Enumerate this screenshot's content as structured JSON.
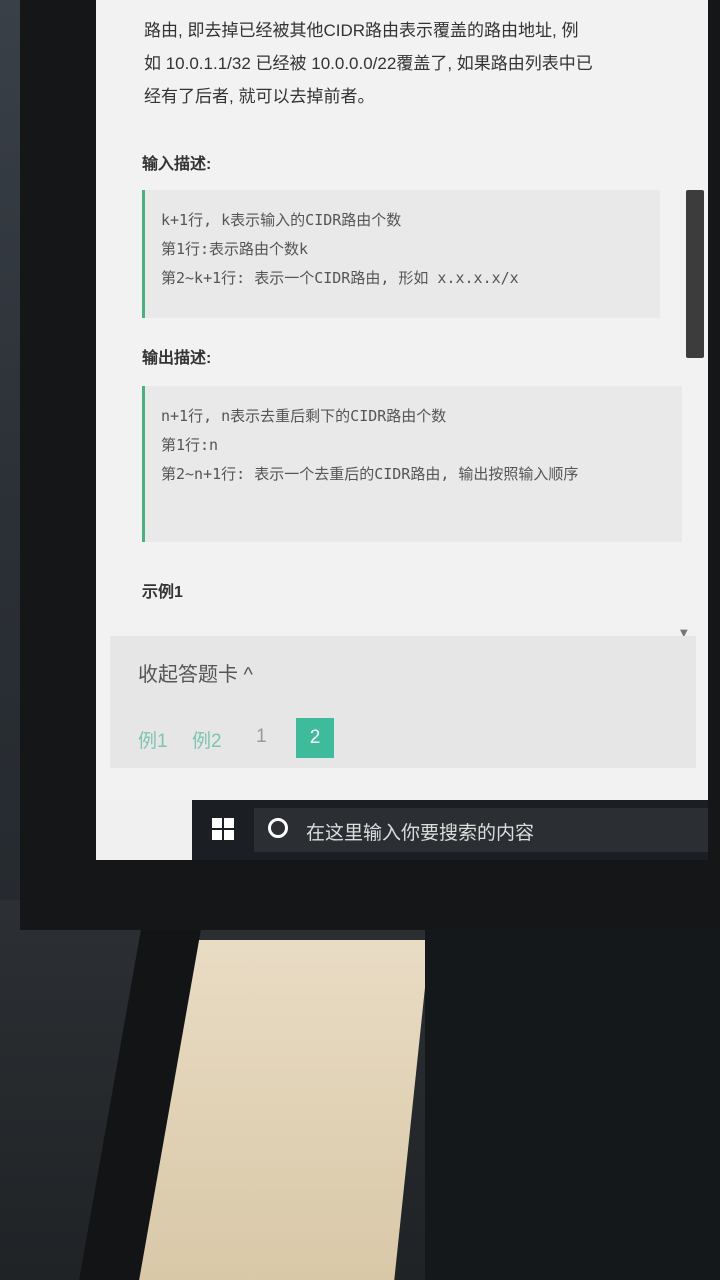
{
  "page": {
    "intro_line1": "路由, 即去掉已经被其他CIDR路由表示覆盖的路由地址, 例",
    "intro_line2": "如 10.0.1.1/32 已经被 10.0.0.0/22覆盖了, 如果路由列表中已",
    "intro_line3": "经有了后者, 就可以去掉前者。"
  },
  "input_section": {
    "title": "输入描述:",
    "lines": [
      "k+1行, k表示输入的CIDR路由个数",
      "第1行:表示路由个数k",
      "第2~k+1行: 表示一个CIDR路由, 形如 x.x.x.x/x"
    ]
  },
  "output_section": {
    "title": "输出描述:",
    "lines": [
      "n+1行, n表示去重后剩下的CIDR路由个数",
      "第1行:n",
      "第2~n+1行: 表示一个去重后的CIDR路由, 输出按照输入顺序"
    ]
  },
  "example": {
    "title": "示例1"
  },
  "answer_card": {
    "collapse_label": "收起答题卡 ^",
    "items": [
      "例1",
      "例2",
      "1",
      "2"
    ],
    "active_index": 3
  },
  "taskbar": {
    "search_placeholder": "在这里输入你要搜索的内容"
  },
  "icons": {
    "start": "windows-logo",
    "search": "cortana-circle",
    "mic": "microphone",
    "task_view": "task-view"
  },
  "colors": {
    "accent": "#3dbb9a",
    "code_border": "#4caf80"
  }
}
